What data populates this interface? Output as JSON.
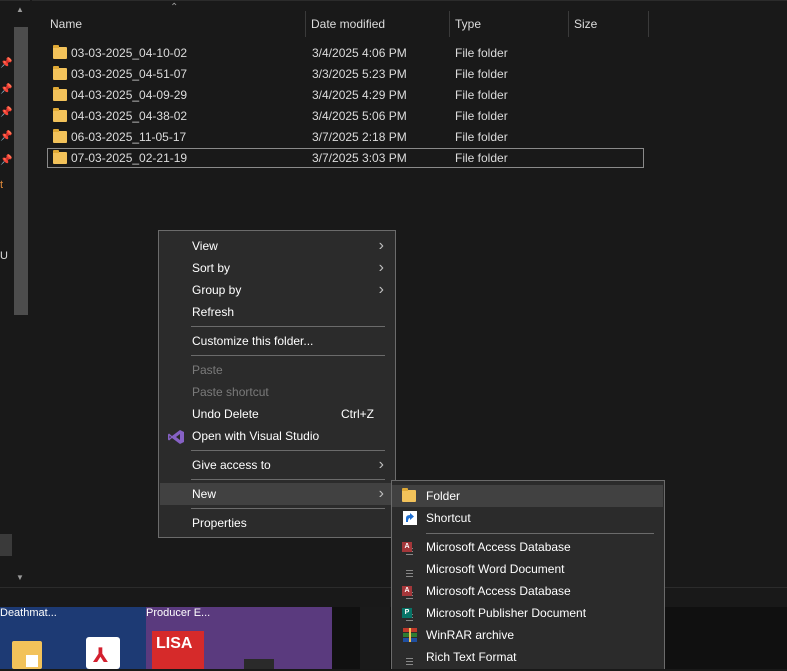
{
  "columns": {
    "name": "Name",
    "date_modified": "Date modified",
    "type": "Type",
    "size": "Size"
  },
  "files": [
    {
      "name": "03-03-2025_04-10-02",
      "date": "3/4/2025 4:06 PM",
      "type": "File folder"
    },
    {
      "name": "03-03-2025_04-51-07",
      "date": "3/3/2025 5:23 PM",
      "type": "File folder"
    },
    {
      "name": "04-03-2025_04-09-29",
      "date": "3/4/2025 4:29 PM",
      "type": "File folder"
    },
    {
      "name": "04-03-2025_04-38-02",
      "date": "3/4/2025 5:06 PM",
      "type": "File folder"
    },
    {
      "name": "06-03-2025_11-05-17",
      "date": "3/7/2025 2:18 PM",
      "type": "File folder"
    },
    {
      "name": "07-03-2025_02-21-19",
      "date": "3/7/2025 3:03 PM",
      "type": "File folder"
    }
  ],
  "nav_fragments": {
    "t": "t",
    "u": "U"
  },
  "context_menu": {
    "view": "View",
    "sort_by": "Sort by",
    "group_by": "Group by",
    "refresh": "Refresh",
    "customize": "Customize this folder...",
    "paste": "Paste",
    "paste_shortcut": "Paste shortcut",
    "undo_delete": "Undo Delete",
    "undo_shortcut": "Ctrl+Z",
    "open_vs": "Open with Visual Studio",
    "give_access": "Give access to",
    "new": "New",
    "properties": "Properties"
  },
  "new_submenu": {
    "folder": "Folder",
    "shortcut": "Shortcut",
    "access_db_1": "Microsoft Access Database",
    "word_doc": "Microsoft Word Document",
    "access_db_2": "Microsoft Access Database",
    "publisher_doc": "Microsoft Publisher Document",
    "winrar": "WinRAR archive",
    "rtf": "Rich Text Format"
  },
  "taskbar": {
    "thumb1_label": "Deathmat...",
    "thumb2_label": "Producer E...",
    "lisa_text": "LISA"
  },
  "colors": {
    "background": "#191919",
    "menu_bg": "#2b2b2b",
    "highlight": "#414141",
    "folder": "#f2c25a",
    "vs_purple": "#8661c5"
  }
}
